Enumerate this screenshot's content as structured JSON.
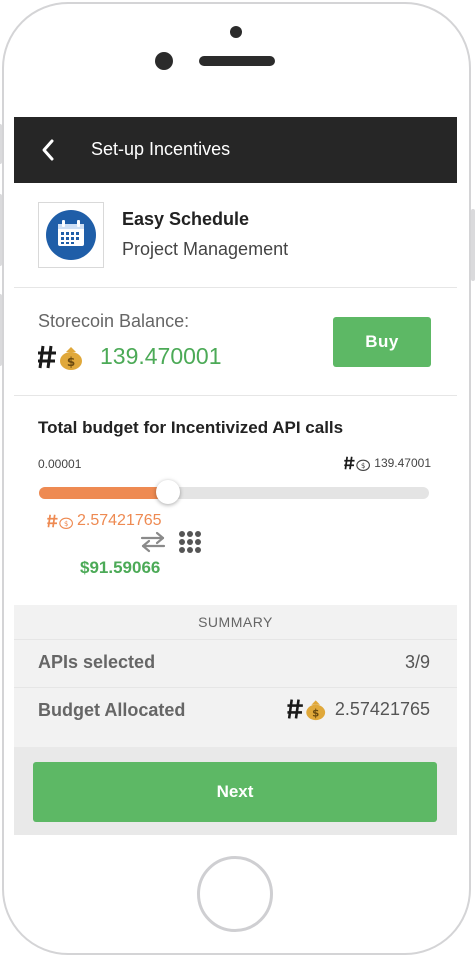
{
  "nav": {
    "title": "Set-up Incentives"
  },
  "app": {
    "name": "Easy Schedule",
    "category": "Project Management"
  },
  "balance": {
    "label": "Storecoin Balance:",
    "value": "139.470001",
    "buy_label": "Buy"
  },
  "budget": {
    "title": "Total budget for Incentivized API calls",
    "min": "0.00001",
    "max": "139.47001",
    "selected_coin": "2.57421765",
    "selected_usd": "$91.59066",
    "slider_fraction": 0.33
  },
  "summary": {
    "header": "SUMMARY",
    "apis_label": "APIs selected",
    "apis_value": "3/9",
    "budget_label": "Budget Allocated",
    "budget_value": "2.57421765"
  },
  "footer": {
    "next_label": "Next"
  },
  "colors": {
    "accent_green": "#5db865",
    "accent_orange": "#ee8a52",
    "nav_bg": "#262626"
  },
  "icons": {
    "back": "chevron-left-icon",
    "app": "calendar-icon",
    "coin": "storecoin-icon",
    "swap": "swap-arrows-icon",
    "dots": "grid-dots-icon"
  }
}
